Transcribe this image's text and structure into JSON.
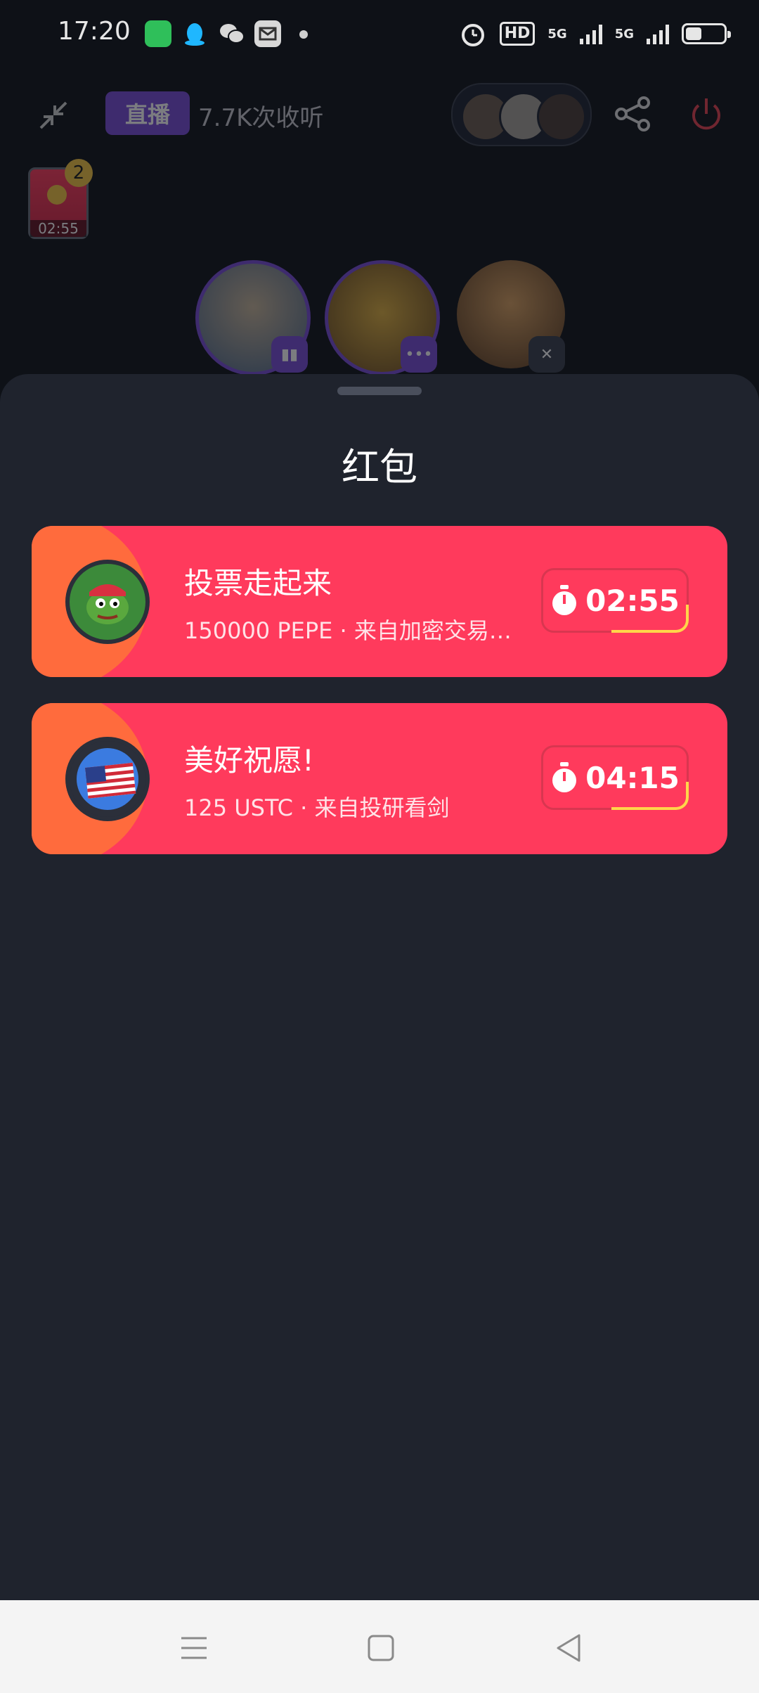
{
  "status_bar": {
    "time": "17:20",
    "hd_label": "HD",
    "network_1": "5G",
    "network_2": "5G",
    "apps": [
      "messages-icon",
      "qq-icon",
      "wechat-icon",
      "mail-icon"
    ]
  },
  "room": {
    "live_label": "直播",
    "listeners": "7.7K次收听",
    "redpacket_timer": "02:55",
    "redpacket_count": "2"
  },
  "sheet": {
    "title": "红包",
    "packets": [
      {
        "title": "投票走起来",
        "subtitle": "150000 PEPE · 来自加密交易…",
        "timer": "02:55",
        "token_icon": "pepe-frog-icon"
      },
      {
        "title": "美好祝愿!",
        "subtitle": "125 USTC · 来自投研看剑",
        "timer": "04:15",
        "token_icon": "us-flag-icon"
      }
    ]
  },
  "colors": {
    "packet_red": "#ff3a5c",
    "packet_orange": "#ff6b3d",
    "timer_accent": "#ffd54a",
    "live_purple": "#7a4bd8",
    "sheet_bg": "#1f232d"
  }
}
